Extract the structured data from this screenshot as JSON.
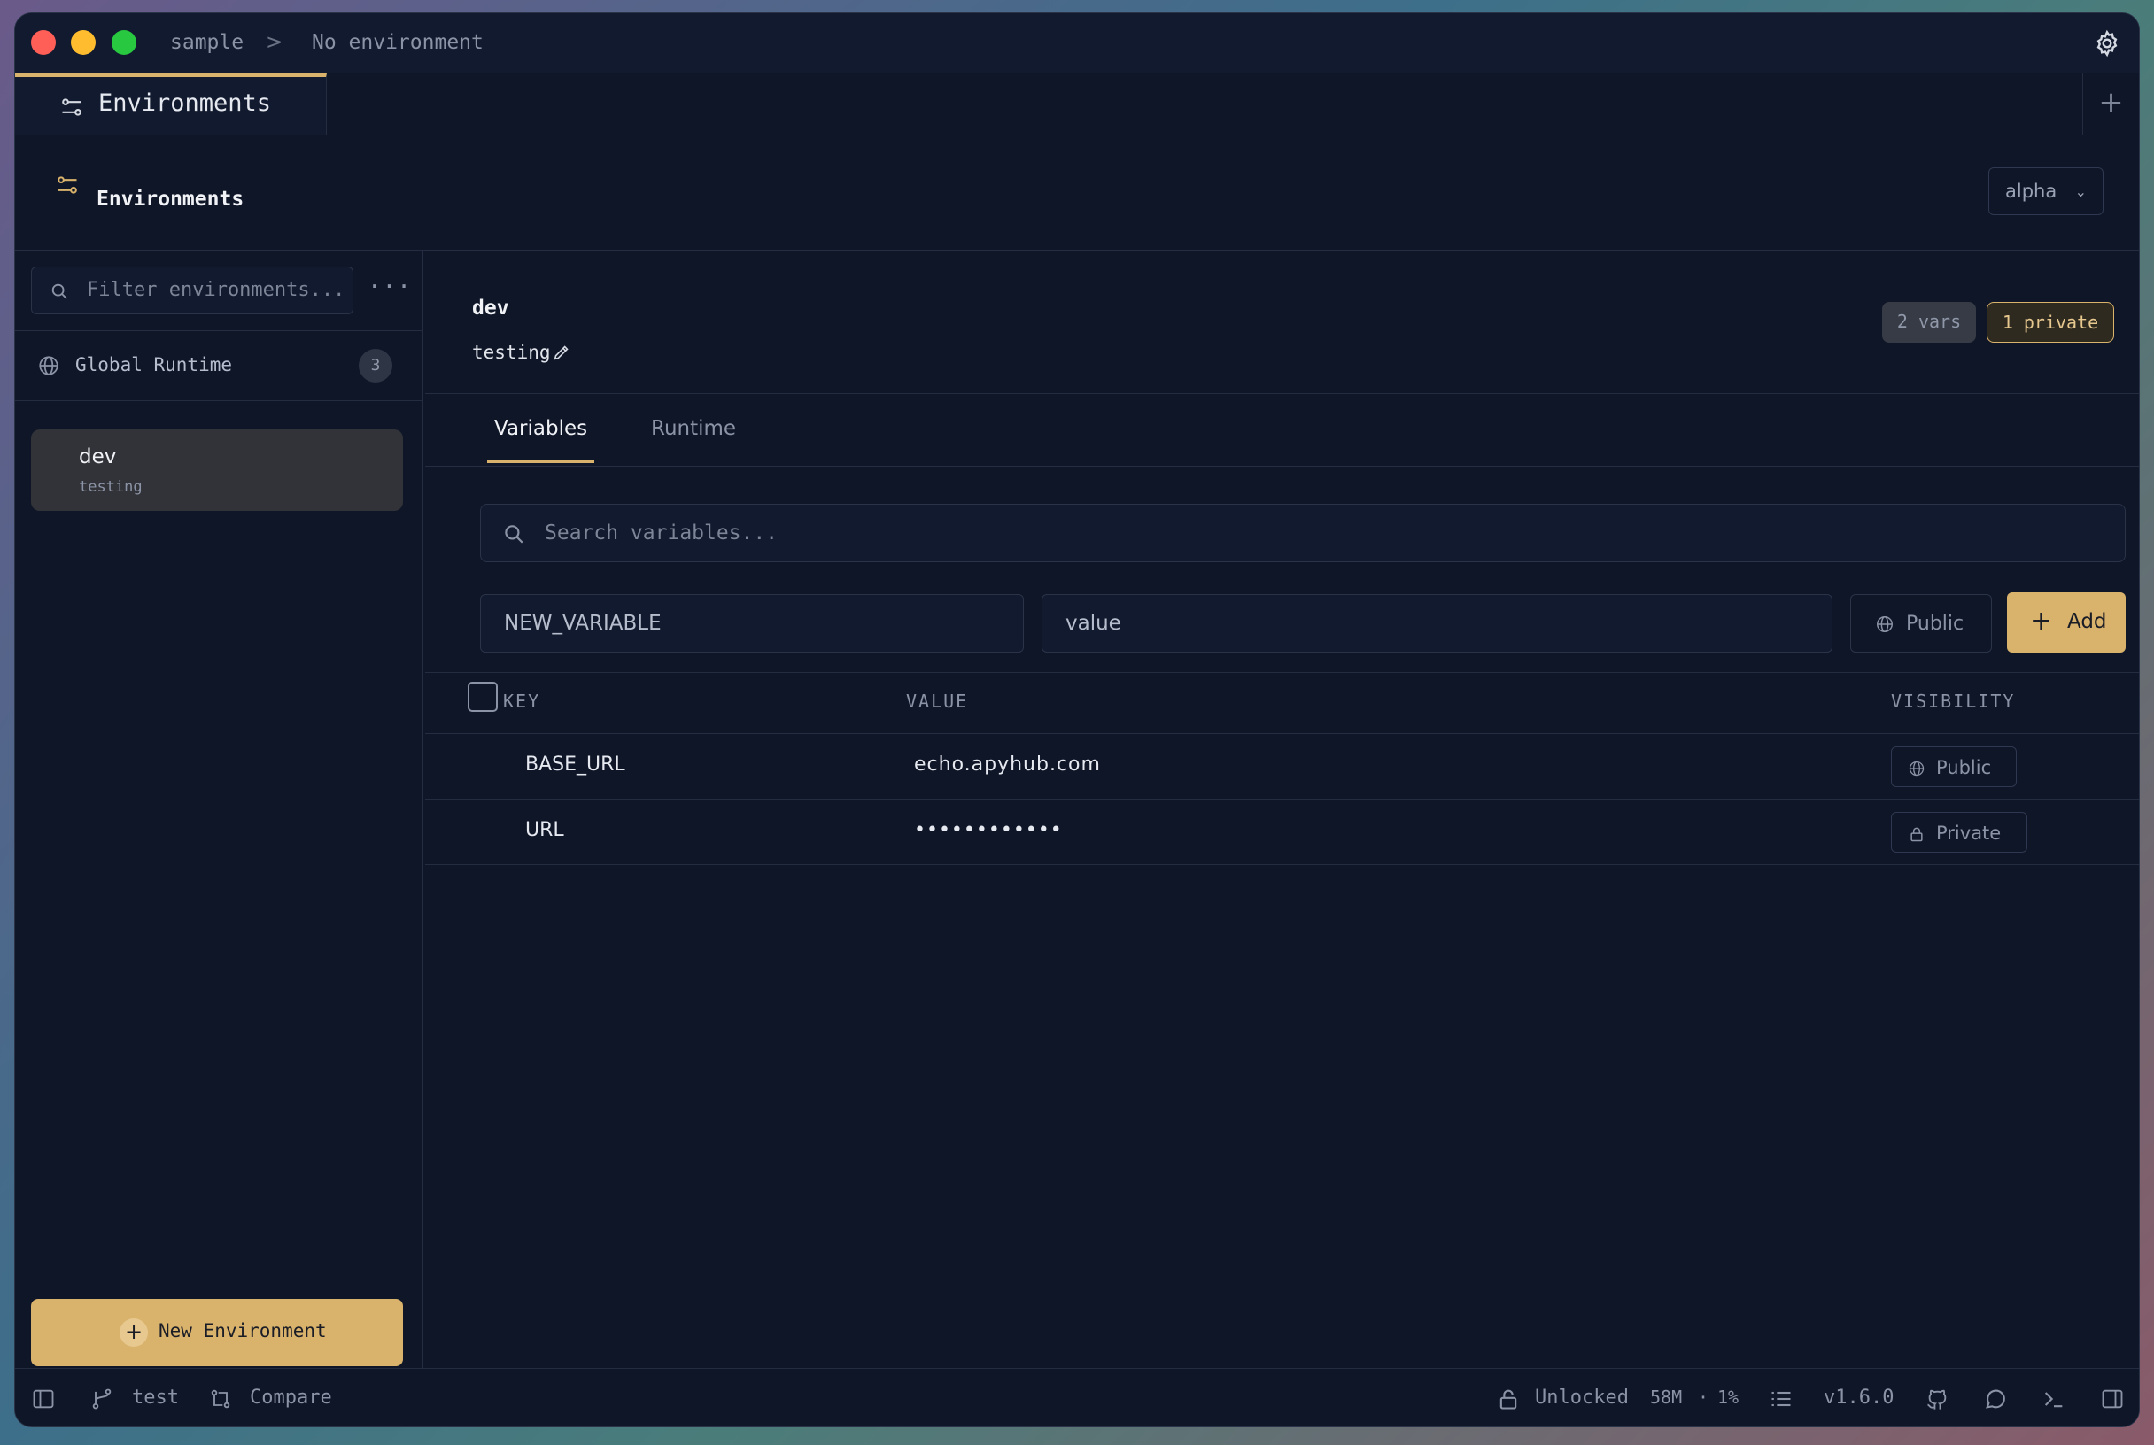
{
  "titlebar": {
    "project": "sample",
    "separator": ">",
    "environment": "No environment"
  },
  "tabs": {
    "active_label": "Environments",
    "add_label": "+"
  },
  "page": {
    "title": "Environments",
    "version_select": "alpha"
  },
  "sidebar": {
    "filter_placeholder": "Filter environments...",
    "more_label": "···",
    "global": {
      "label": "Global Runtime",
      "count": "3"
    },
    "items": [
      {
        "name": "dev",
        "description": "testing"
      }
    ],
    "new_button": "New Environment"
  },
  "env": {
    "name": "dev",
    "description": "testing",
    "vars_badge": "2 vars",
    "private_badge": "1 private",
    "tabs": [
      "Variables",
      "Runtime"
    ],
    "search_placeholder": "Search variables...",
    "new_key_placeholder": "NEW_VARIABLE",
    "new_value_placeholder": "value",
    "visibility_toggle": "Public",
    "add_button": "Add"
  },
  "table": {
    "headers": {
      "key": "KEY",
      "value": "VALUE",
      "visibility": "VISIBILITY"
    },
    "rows": [
      {
        "key": "BASE_URL",
        "value": "echo.apyhub.com",
        "visibility": "Public"
      },
      {
        "key": "URL",
        "value": "••••••••••••",
        "visibility": "Private"
      }
    ]
  },
  "statusbar": {
    "branch": "test",
    "compare": "Compare",
    "lock": "Unlocked",
    "memory": "58M",
    "dot": "·",
    "cpu": "1%",
    "version": "v1.6.0"
  },
  "colors": {
    "accent": "#d9b26c",
    "background": "#0f1628",
    "border": "#232c40"
  }
}
